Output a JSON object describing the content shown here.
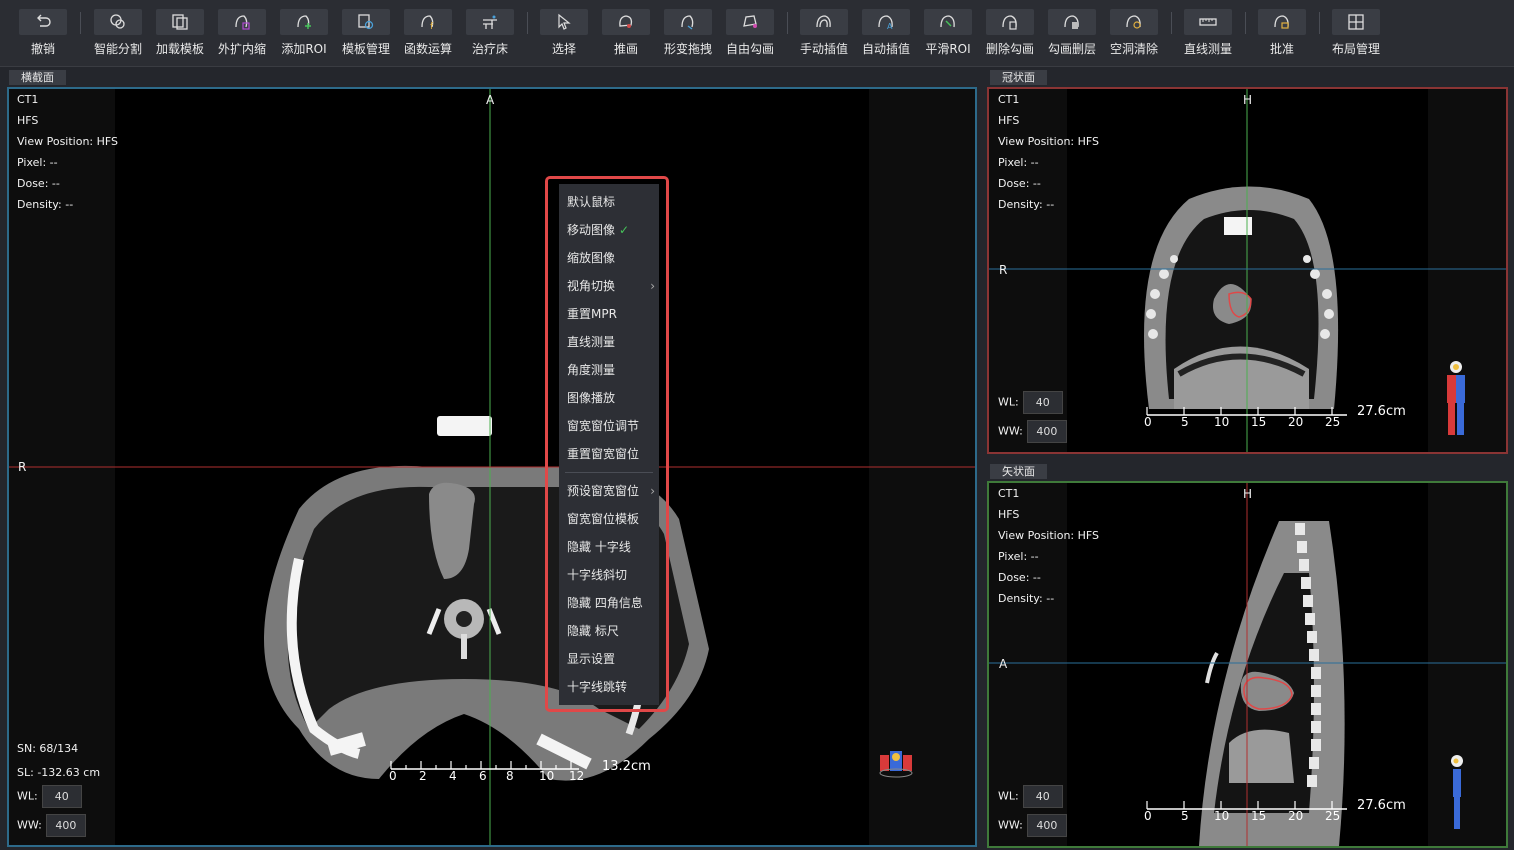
{
  "toolbar": {
    "items": [
      {
        "label": "撤销",
        "icon": "undo-icon"
      },
      {
        "label": "智能分割",
        "icon": "smart-segment-icon"
      },
      {
        "label": "加载模板",
        "icon": "load-template-icon"
      },
      {
        "label": "外扩内缩",
        "icon": "expand-shrink-icon"
      },
      {
        "label": "添加ROI",
        "icon": "add-roi-icon"
      },
      {
        "label": "模板管理",
        "icon": "template-manage-icon"
      },
      {
        "label": "函数运算",
        "icon": "function-icon"
      },
      {
        "label": "治疗床",
        "icon": "couch-icon"
      },
      {
        "label": "选择",
        "icon": "select-cursor-icon"
      },
      {
        "label": "推画",
        "icon": "push-draw-icon"
      },
      {
        "label": "形变拖拽",
        "icon": "deform-drag-icon"
      },
      {
        "label": "自由勾画",
        "icon": "free-draw-icon"
      },
      {
        "label": "手动插值",
        "icon": "manual-interp-icon"
      },
      {
        "label": "自动插值",
        "icon": "auto-interp-icon"
      },
      {
        "label": "平滑ROI",
        "icon": "smooth-roi-icon"
      },
      {
        "label": "删除勾画",
        "icon": "delete-contour-icon"
      },
      {
        "label": "勾画删层",
        "icon": "delete-slice-icon"
      },
      {
        "label": "空洞清除",
        "icon": "hole-clear-icon"
      },
      {
        "label": "直线测量",
        "icon": "ruler-icon"
      },
      {
        "label": "批准",
        "icon": "approve-lock-icon"
      },
      {
        "label": "布局管理",
        "icon": "layout-icon"
      }
    ]
  },
  "axial": {
    "tab": "横截面",
    "top_orient": "A",
    "left_orient": "R",
    "info": {
      "series": "CT1",
      "position": "HFS",
      "view_position": "View Position: HFS",
      "pixel": "Pixel: --",
      "dose": "Dose: --",
      "density": "Density: --"
    },
    "sn": "SN: 68/134",
    "sl": "SL: -132.63 cm",
    "wl_label": "WL:",
    "wl_value": "40",
    "ww_label": "WW:",
    "ww_value": "400",
    "scale_ticks": [
      "0",
      "2",
      "4",
      "6",
      "8",
      "10",
      "12"
    ],
    "scale_length": "13.2cm"
  },
  "coronal": {
    "tab": "冠状面",
    "top_orient": "H",
    "left_orient": "R",
    "info": {
      "series": "CT1",
      "position": "HFS",
      "view_position": "View Position: HFS",
      "pixel": "Pixel: --",
      "dose": "Dose: --",
      "density": "Density: --"
    },
    "wl_label": "WL:",
    "wl_value": "40",
    "ww_label": "WW:",
    "ww_value": "400",
    "scale_ticks": [
      "0",
      "5",
      "10",
      "15",
      "20",
      "25"
    ],
    "scale_length": "27.6cm"
  },
  "sagittal": {
    "tab": "矢状面",
    "top_orient": "H",
    "left_orient": "A",
    "info": {
      "series": "CT1",
      "position": "HFS",
      "view_position": "View Position: HFS",
      "pixel": "Pixel: --",
      "dose": "Dose: --",
      "density": "Density: --"
    },
    "wl_label": "WL:",
    "wl_value": "40",
    "ww_label": "WW:",
    "ww_value": "400",
    "scale_ticks": [
      "0",
      "5",
      "10",
      "15",
      "20",
      "25"
    ],
    "scale_length": "27.6cm"
  },
  "context_menu": {
    "items": [
      {
        "label": "默认鼠标"
      },
      {
        "label": "移动图像",
        "checked": "✓"
      },
      {
        "label": "缩放图像"
      },
      {
        "label": "视角切换",
        "submenu": "›"
      },
      {
        "label": "重置MPR"
      },
      {
        "label": "直线测量"
      },
      {
        "label": "角度测量"
      },
      {
        "label": "图像播放"
      },
      {
        "label": "窗宽窗位调节"
      },
      {
        "label": "重置窗宽窗位"
      },
      {
        "label": "预设窗宽窗位",
        "submenu": "›"
      },
      {
        "label": "窗宽窗位模板"
      },
      {
        "label": "隐藏 十字线"
      },
      {
        "label": "十字线斜切"
      },
      {
        "label": "隐藏 四角信息"
      },
      {
        "label": "隐藏 标尺"
      },
      {
        "label": "显示设置"
      },
      {
        "label": "十字线跳转"
      }
    ]
  },
  "colors": {
    "accent_red": "#e04848",
    "crosshair_green": "#4caf50",
    "crosshair_red": "#b03030",
    "crosshair_blue": "#2a6f9a"
  }
}
